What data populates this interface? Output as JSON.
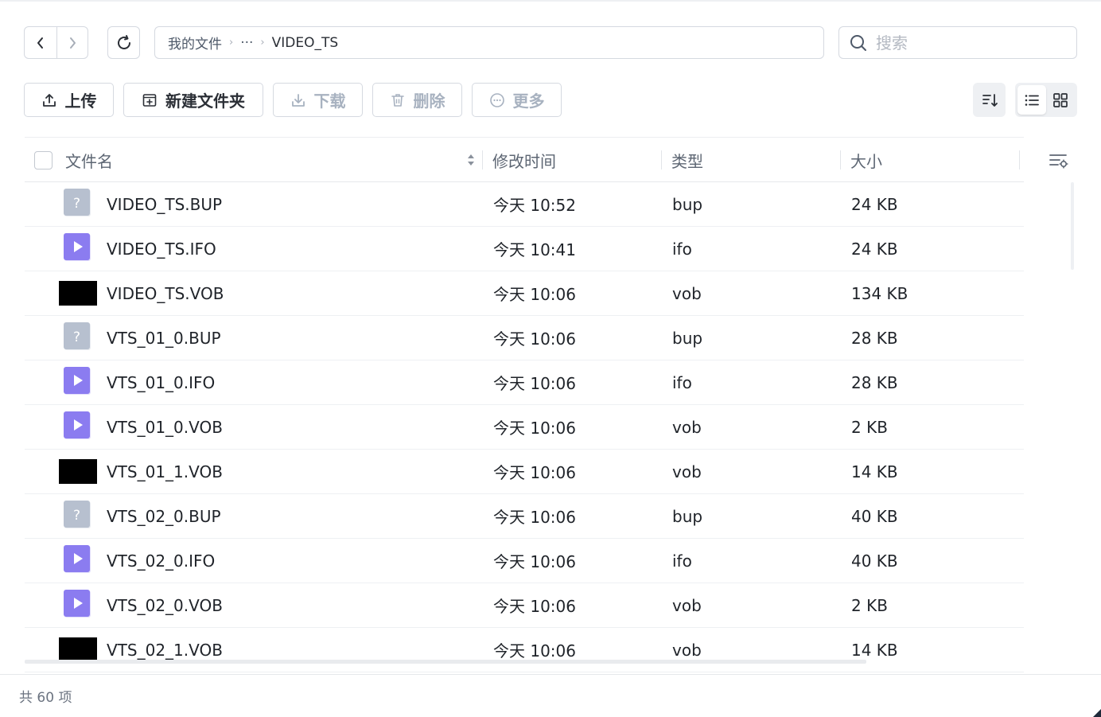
{
  "breadcrumb": {
    "root": "我的文件",
    "ellipsis": "···",
    "current": "VIDEO_TS"
  },
  "search": {
    "placeholder": "搜索"
  },
  "toolbar": {
    "upload": "上传",
    "new_folder": "新建文件夹",
    "download": "下载",
    "delete": "删除",
    "more": "更多"
  },
  "table": {
    "col_name": "文件名",
    "col_modified": "修改时间",
    "col_type": "类型",
    "col_size": "大小"
  },
  "files": [
    {
      "name": "VIDEO_TS.BUP",
      "modified": "今天 10:52",
      "type": "bup",
      "size": "24 KB",
      "icon": "unknown-file-icon"
    },
    {
      "name": "VIDEO_TS.IFO",
      "modified": "今天 10:41",
      "type": "ifo",
      "size": "24 KB",
      "icon": "video-file-icon"
    },
    {
      "name": "VIDEO_TS.VOB",
      "modified": "今天 10:06",
      "type": "vob",
      "size": "134 KB",
      "icon": "black-thumbnail"
    },
    {
      "name": "VTS_01_0.BUP",
      "modified": "今天 10:06",
      "type": "bup",
      "size": "28 KB",
      "icon": "unknown-file-icon"
    },
    {
      "name": "VTS_01_0.IFO",
      "modified": "今天 10:06",
      "type": "ifo",
      "size": "28 KB",
      "icon": "video-file-icon"
    },
    {
      "name": "VTS_01_0.VOB",
      "modified": "今天 10:06",
      "type": "vob",
      "size": "2 KB",
      "icon": "video-file-icon"
    },
    {
      "name": "VTS_01_1.VOB",
      "modified": "今天 10:06",
      "type": "vob",
      "size": "14 KB",
      "icon": "black-thumbnail"
    },
    {
      "name": "VTS_02_0.BUP",
      "modified": "今天 10:06",
      "type": "bup",
      "size": "40 KB",
      "icon": "unknown-file-icon"
    },
    {
      "name": "VTS_02_0.IFO",
      "modified": "今天 10:06",
      "type": "ifo",
      "size": "40 KB",
      "icon": "video-file-icon"
    },
    {
      "name": "VTS_02_0.VOB",
      "modified": "今天 10:06",
      "type": "vob",
      "size": "2 KB",
      "icon": "video-file-icon"
    },
    {
      "name": "VTS_02_1.VOB",
      "modified": "今天 10:06",
      "type": "vob",
      "size": "14 KB",
      "icon": "black-thumbnail"
    }
  ],
  "footer": {
    "count": "共 60 项"
  },
  "colors": {
    "video_icon": "#8b7cf0",
    "unknown_icon": "#b7c0cf",
    "border": "#d5d9e0",
    "disabled_text": "#a8b2c0"
  }
}
